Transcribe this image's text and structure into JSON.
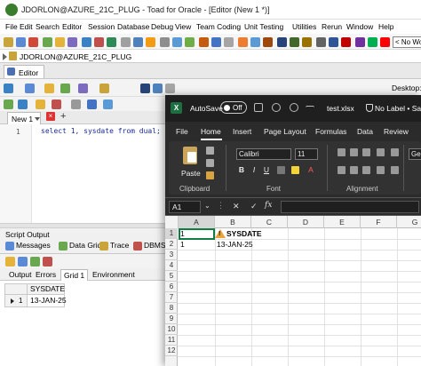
{
  "toad": {
    "title": "JDORLON@AZURE_21C_PLUG - Toad for Oracle - [Editor (New 1 *)]",
    "menu": [
      "File",
      "Edit",
      "Search",
      "Editor",
      "Session",
      "Database",
      "Debug",
      "View",
      "Team Coding",
      "Unit Testing",
      "Utilities",
      "Rerun",
      "Window",
      "Help"
    ],
    "no_workspace": "< No Wor",
    "connection": "JDORLON@AZURE_21C_PLUG",
    "editor_tab": "Editor",
    "desktop_label": "Desktop:",
    "query_tab": "New 1",
    "editor": {
      "line_number": "1",
      "code": "select 1, sysdate from dual;"
    },
    "script_output": "Script Output",
    "output_tabs": [
      "Messages",
      "Data Grid",
      "Trace",
      "DBMS"
    ],
    "sub_tabs": [
      "Output",
      "Errors",
      "Grid 1",
      "Environment"
    ],
    "grid": {
      "column": "SYSDATE",
      "row_number": "1",
      "value": "13-JAN-25"
    }
  },
  "excel": {
    "autosave": "AutoSave",
    "autosave_state": "Off",
    "filename": "test.xlsx",
    "label": "No Label • Save",
    "ribbon_tabs": [
      "File",
      "Home",
      "Insert",
      "Page Layout",
      "Formulas",
      "Data",
      "Review"
    ],
    "active_tab": "Home",
    "paste": "Paste",
    "font_name": "Calibri",
    "font_size": "11",
    "format_dropdown": "Gene",
    "groups": {
      "clipboard": "Clipboard",
      "font": "Font",
      "alignment": "Alignment"
    },
    "name_box": "A1",
    "fx": "fx",
    "columns": [
      "A",
      "B",
      "C",
      "D",
      "E",
      "F",
      "G"
    ],
    "rows": [
      "1",
      "2",
      "3",
      "4",
      "5",
      "6",
      "7",
      "8",
      "9",
      "10",
      "11",
      "12"
    ],
    "cells": {
      "A1": "1",
      "B1": "SYSDATE",
      "A2": "1",
      "B2": "13-JAN-25"
    }
  }
}
